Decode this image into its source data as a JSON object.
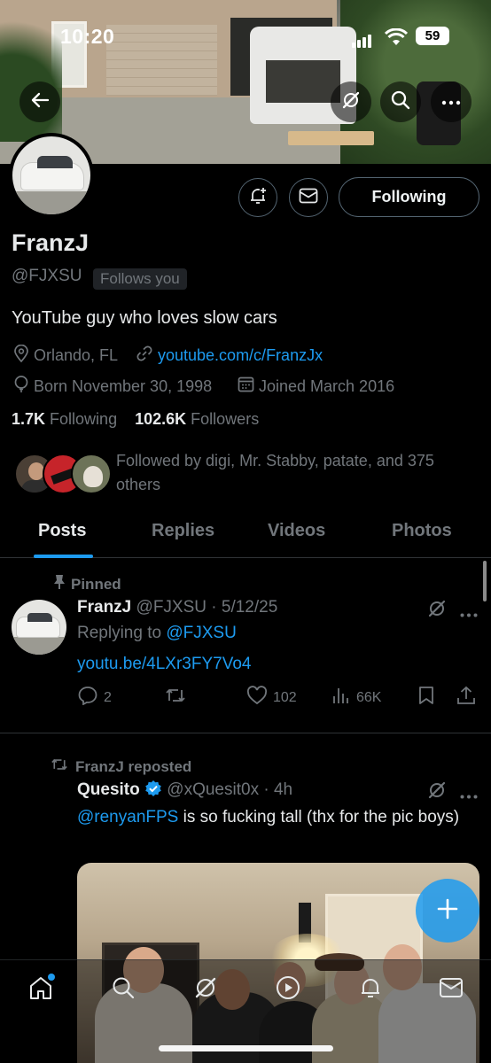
{
  "status_bar": {
    "time": "10:20",
    "battery": "59"
  },
  "profile": {
    "name": "FranzJ",
    "handle": "@FJXSU",
    "follows_you": "Follows you",
    "bio": "YouTube guy who loves slow cars",
    "location": "Orlando, FL",
    "website": "youtube.com/c/FranzJx",
    "birthday": "Born November 30, 1998",
    "joined": "Joined March 2016",
    "following_count": "1.7K",
    "following_label": "Following",
    "followers_count": "102.6K",
    "followers_label": "Followers",
    "followed_by": "Followed by digi, Mr. Stabby, patate, and 375 others",
    "follow_button": "Following"
  },
  "tabs": [
    "Posts",
    "Replies",
    "Videos",
    "Photos"
  ],
  "active_tab": "Posts",
  "posts": [
    {
      "context": "Pinned",
      "name": "FranzJ",
      "handle": "@FJXSU",
      "date": "5/12/25",
      "replying_to_label": "Replying to",
      "replying_to": "@FJXSU",
      "link": "youtu.be/4LXr3FY7Vo4",
      "replies": "2",
      "reposts": "",
      "likes": "102",
      "views": "66K"
    },
    {
      "context": "FranzJ reposted",
      "name": "Quesito",
      "handle": "@xQuesit0x",
      "date": "4h",
      "mention": "@renyanFPS",
      "text": " is so fucking tall (thx for the pic boys)"
    }
  ],
  "icons": {
    "back": "back-arrow-icon",
    "grok": "grok-icon",
    "search": "search-icon",
    "more": "more-icon",
    "notify": "bell-plus-icon",
    "message": "envelope-icon"
  },
  "colors": {
    "accent": "#1d9bf0",
    "background": "#000000",
    "muted": "#71767b",
    "text": "#e7e9ea"
  }
}
